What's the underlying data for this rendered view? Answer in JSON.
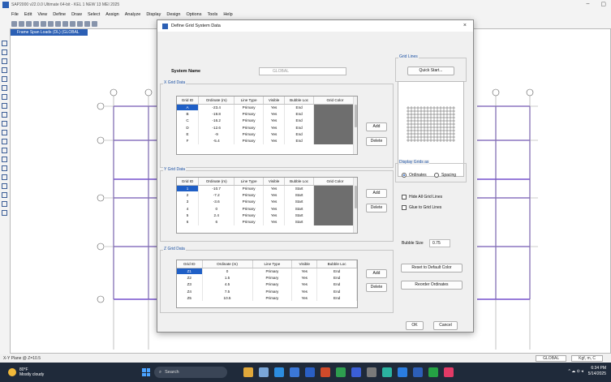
{
  "window": {
    "title": "SAP2000 v22.0.0 Ultimate 64-bit - KEL 1 NEW 13 MEI 2025",
    "controls": [
      "–",
      "▢"
    ]
  },
  "menu": [
    "File",
    "Edit",
    "View",
    "Define",
    "Draw",
    "Select",
    "Assign",
    "Analyze",
    "Display",
    "Design",
    "Options",
    "Tools",
    "Help"
  ],
  "canvas": {
    "tab_title": "Frame Span Loads (DL) (GLOBAL CSys)"
  },
  "status": {
    "plane": "X-Y Plane @ Z=10.5",
    "coord_sys": "GLOBAL",
    "units": "Kgf, m, C"
  },
  "taskbar": {
    "weather_temp": "80°F",
    "weather_desc": "Mostly cloudy",
    "search_placeholder": "Search",
    "time": "6:34 PM",
    "date": "5/14/2025"
  },
  "dialog": {
    "title": "Define Grid System Data",
    "close": "×",
    "system_name_label": "System Name",
    "system_name_value": "GLOBAL",
    "x_grid": {
      "title": "X Grid Data",
      "headers": [
        "Grid ID",
        "Ordinate (m)",
        "Line Type",
        "Visible",
        "Bubble Loc",
        "Grid Color"
      ],
      "rows": [
        [
          "A",
          "-23.4",
          "Primary",
          "Yes",
          "End"
        ],
        [
          "B",
          "-19.8",
          "Primary",
          "Yes",
          "End"
        ],
        [
          "C",
          "-16.2",
          "Primary",
          "Yes",
          "End"
        ],
        [
          "D",
          "-12.6",
          "Primary",
          "Yes",
          "End"
        ],
        [
          "E",
          "-9",
          "Primary",
          "Yes",
          "End"
        ],
        [
          "F",
          "-5.4",
          "Primary",
          "Yes",
          "End"
        ]
      ],
      "add": "Add",
      "delete": "Delete"
    },
    "y_grid": {
      "title": "Y Grid Data",
      "headers": [
        "Grid ID",
        "Ordinate (m)",
        "Line Type",
        "Visible",
        "Bubble Loc",
        "Grid Color"
      ],
      "rows": [
        [
          "1",
          "-10.7",
          "Primary",
          "Yes",
          "Start"
        ],
        [
          "2",
          "-7.2",
          "Primary",
          "Yes",
          "Start"
        ],
        [
          "3",
          "-3.6",
          "Primary",
          "Yes",
          "Start"
        ],
        [
          "4",
          "0",
          "Primary",
          "Yes",
          "Start"
        ],
        [
          "5",
          "2.4",
          "Primary",
          "Yes",
          "Start"
        ],
        [
          "6",
          "6",
          "Primary",
          "Yes",
          "Start"
        ]
      ],
      "add": "Add",
      "delete": "Delete"
    },
    "z_grid": {
      "title": "Z Grid Data",
      "headers": [
        "Grid ID",
        "Ordinate (m)",
        "Line Type",
        "Visible",
        "Bubble Loc"
      ],
      "rows": [
        [
          "Z1",
          "0",
          "Primary",
          "Yes",
          "End"
        ],
        [
          "Z2",
          "1.5",
          "Primary",
          "Yes",
          "End"
        ],
        [
          "Z3",
          "4.5",
          "Primary",
          "Yes",
          "End"
        ],
        [
          "Z4",
          "7.5",
          "Primary",
          "Yes",
          "End"
        ],
        [
          "Z5",
          "10.5",
          "Primary",
          "Yes",
          "End"
        ]
      ],
      "add": "Add",
      "delete": "Delete"
    },
    "grid_lines": {
      "title": "Grid Lines",
      "quick_start": "Quick Start..."
    },
    "display_grids_as": {
      "title": "Display Grids as",
      "ordinates": "Ordinates",
      "spacing": "Spacing",
      "selected": "Ordinates"
    },
    "hide_all": "Hide All Grid Lines",
    "glue": "Glue to Grid Lines",
    "bubble_size_label": "Bubble Size",
    "bubble_size_value": "0.75",
    "reset_color": "Reset to Default Color",
    "reorder": "Reorder Ordinates",
    "ok": "OK",
    "cancel": "Cancel"
  },
  "colors": {
    "accent": "#1f5fc6",
    "frame_line": "#5a2fc4",
    "grid_color": "#6e6e6e",
    "taskbar": "#1f2a3a"
  },
  "icons": {
    "window_close": "close-icon",
    "search": "search-icon",
    "start": "windows-start-icon"
  }
}
